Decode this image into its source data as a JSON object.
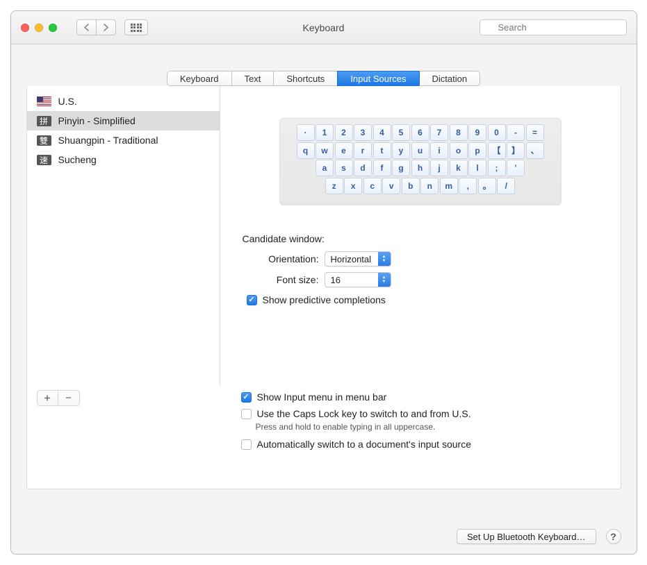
{
  "window": {
    "title": "Keyboard"
  },
  "search": {
    "placeholder": "Search"
  },
  "tabs": {
    "keyboard": "Keyboard",
    "text": "Text",
    "shortcuts": "Shortcuts",
    "input_sources": "Input Sources",
    "dictation": "Dictation"
  },
  "sources": {
    "us": "U.S.",
    "pinyin": "Pinyin - Simplified",
    "shuangpin": "Shuangpin - Traditional",
    "sucheng": "Sucheng",
    "pinyin_glyph": "拼",
    "shuangpin_glyph": "雙",
    "sucheng_glyph": "速"
  },
  "keyboard_rows": {
    "r1": [
      "·",
      "1",
      "2",
      "3",
      "4",
      "5",
      "6",
      "7",
      "8",
      "9",
      "0",
      "-",
      "="
    ],
    "r2": [
      "q",
      "w",
      "e",
      "r",
      "t",
      "y",
      "u",
      "i",
      "o",
      "p",
      "【",
      "】",
      "、"
    ],
    "r3": [
      "a",
      "s",
      "d",
      "f",
      "g",
      "h",
      "j",
      "k",
      "l",
      ";",
      "'"
    ],
    "r4": [
      "z",
      "x",
      "c",
      "v",
      "b",
      "n",
      "m",
      ",",
      "。",
      "/"
    ]
  },
  "candidate": {
    "title": "Candidate window:",
    "orientation_label": "Orientation:",
    "orientation_value": "Horizontal",
    "fontsize_label": "Font size:",
    "fontsize_value": "16",
    "predictive_label": "Show predictive completions"
  },
  "options": {
    "show_menu": "Show Input menu in menu bar",
    "caps_lock": "Use the Caps Lock key to switch to and from U.S.",
    "caps_hint": "Press and hold to enable typing in all uppercase.",
    "auto_switch": "Automatically switch to a document's input source"
  },
  "footer": {
    "bluetooth": "Set Up Bluetooth Keyboard…"
  }
}
